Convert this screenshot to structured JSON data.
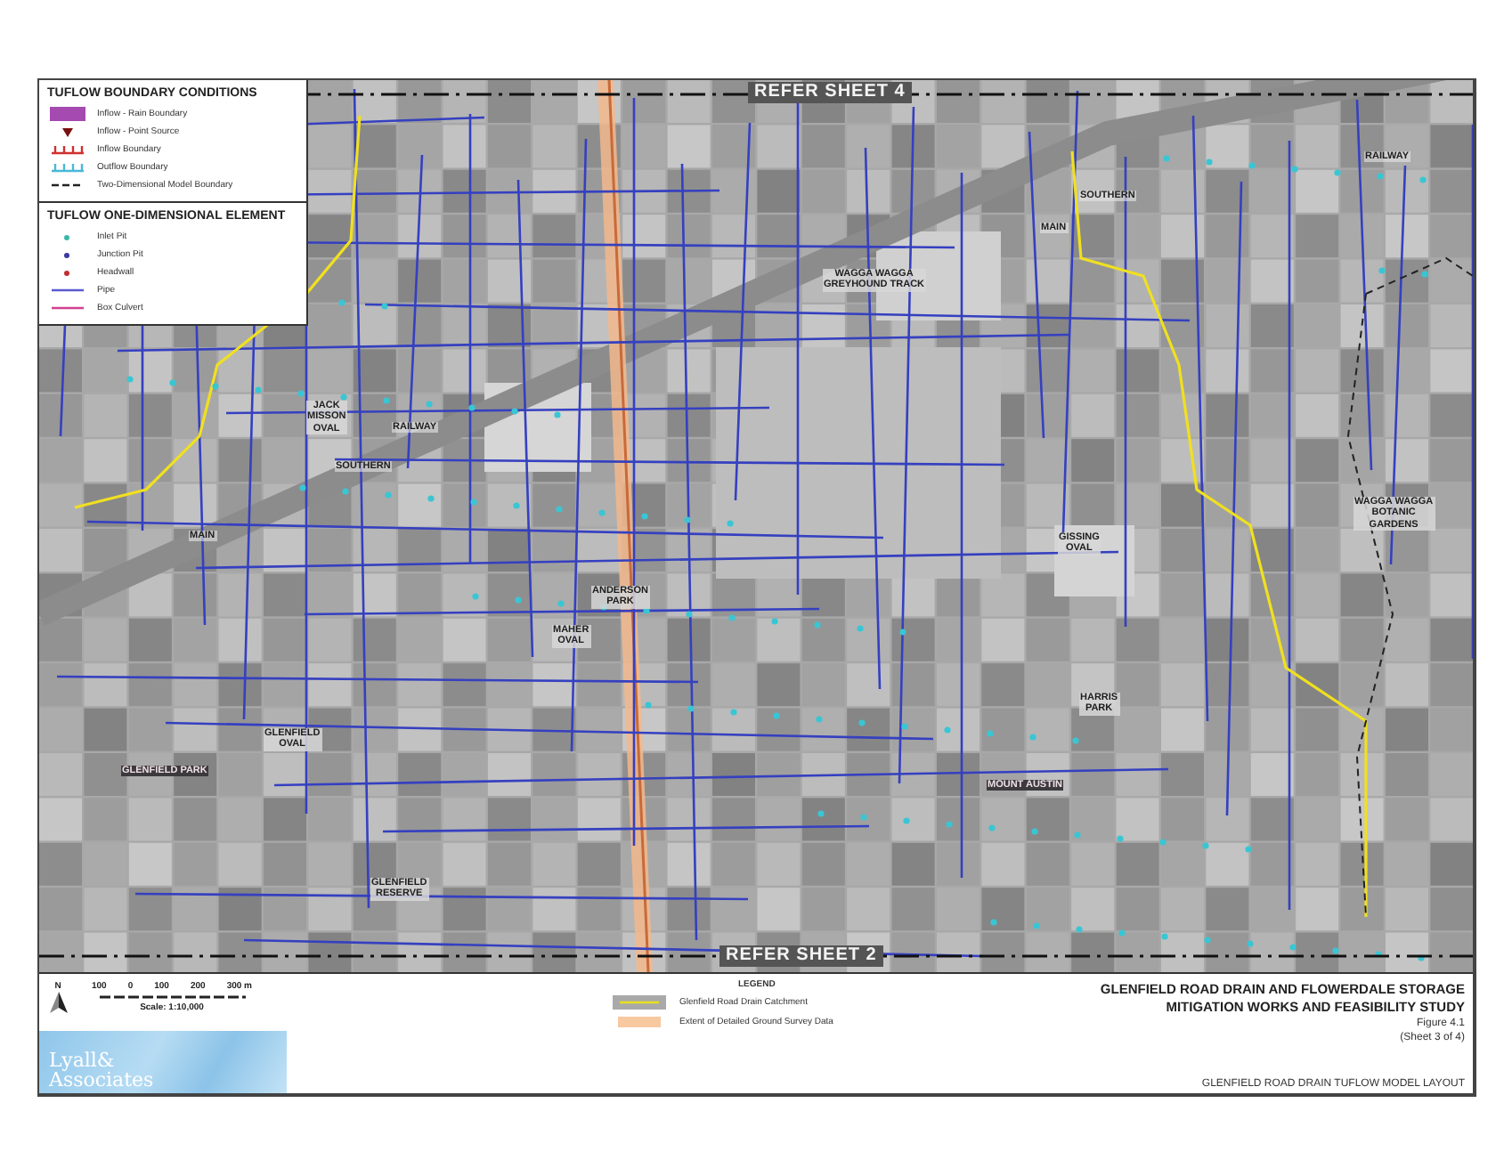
{
  "map": {
    "labels": [
      {
        "text": "REFER SHEET 4",
        "kind": "sheet"
      },
      {
        "text": "RAILWAY",
        "kind": "road"
      },
      {
        "text": "SOUTHERN",
        "kind": "road"
      },
      {
        "text": "MAIN",
        "kind": "road"
      },
      {
        "text": "WAGGA WAGGA\nGREYHOUND TRACK",
        "kind": "place"
      },
      {
        "text": "JACK\nMISSON\nOVAL",
        "kind": "place"
      },
      {
        "text": "RAILWAY",
        "kind": "road"
      },
      {
        "text": "SOUTHERN",
        "kind": "road"
      },
      {
        "text": "MAIN",
        "kind": "road"
      },
      {
        "text": "GISSING\nOVAL",
        "kind": "place"
      },
      {
        "text": "WAGGA WAGGA\nBOTANIC\nGARDENS",
        "kind": "place"
      },
      {
        "text": "ANDERSON\nPARK",
        "kind": "place"
      },
      {
        "text": "MAHER\nOVAL",
        "kind": "place"
      },
      {
        "text": "HARRIS\nPARK",
        "kind": "place"
      },
      {
        "text": "GLENFIELD\nOVAL",
        "kind": "place"
      },
      {
        "text": "GLENFIELD PARK",
        "kind": "suburb"
      },
      {
        "text": "MOUNT AUSTIN",
        "kind": "suburb"
      },
      {
        "text": "GLENFIELD\nRESERVE",
        "kind": "place"
      },
      {
        "text": "REFER SHEET 2",
        "kind": "sheet"
      }
    ]
  },
  "boundary_legend": {
    "title": "TUFLOW BOUNDARY CONDITIONS",
    "items": [
      {
        "label": "Inflow - Rain Boundary",
        "kind": "rain"
      },
      {
        "label": "Inflow - Point Source",
        "kind": "point"
      },
      {
        "label": "Inflow Boundary",
        "kind": "inflow"
      },
      {
        "label": "Outflow Boundary",
        "kind": "outflow"
      },
      {
        "label": "Two-Dimensional Model Boundary",
        "kind": "boundary"
      }
    ]
  },
  "element_legend": {
    "title": "TUFLOW ONE-DIMENSIONAL ELEMENT",
    "items": [
      {
        "label": "Inlet Pit",
        "kind": "inlet"
      },
      {
        "label": "Junction Pit",
        "kind": "junction"
      },
      {
        "label": "Headwall",
        "kind": "headwall"
      },
      {
        "label": "Pipe",
        "kind": "pipe"
      },
      {
        "label": "Box Culvert",
        "kind": "culvert"
      }
    ]
  },
  "scale": {
    "north": "N",
    "ticks": [
      "100",
      "0",
      "100",
      "200",
      "300 m"
    ],
    "caption": "Scale: 1:10,000"
  },
  "logo": {
    "lines": [
      "Lyall&",
      "Associates"
    ]
  },
  "legend": {
    "title": "LEGEND",
    "items": [
      {
        "label": "Glenfield Road Drain Catchment",
        "kind": "catchment"
      },
      {
        "label": "Extent of Detailed Ground Survey Data",
        "kind": "survey"
      }
    ]
  },
  "title_block": {
    "title_lines": [
      "GLENFIELD ROAD DRAIN AND FLOWERDALE STORAGE",
      "MITIGATION WORKS AND FEASIBILITY STUDY"
    ],
    "figure": "Figure 4.1",
    "sheet": "(Sheet 3 of 4)",
    "drawing_title": "GLENFIELD ROAD DRAIN TUFLOW MODEL LAYOUT"
  }
}
